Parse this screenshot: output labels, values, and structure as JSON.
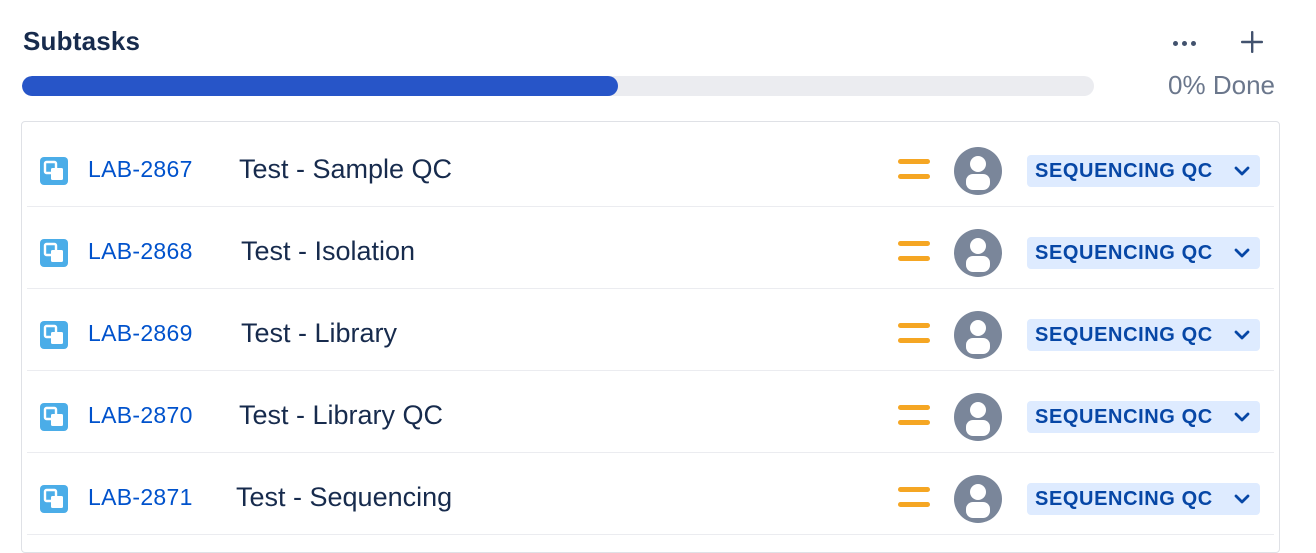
{
  "header": {
    "title": "Subtasks",
    "more_icon": "more-horizontal-icon",
    "add_icon": "plus-icon"
  },
  "progress": {
    "fill_fraction": 0.556,
    "done_text": "0% Done",
    "fill_color": "#2755c8",
    "track_color": "#ebecf0"
  },
  "colors": {
    "key_link": "#0052cc",
    "priority_medium": "#f5a623",
    "status_bg": "#deebff",
    "status_text": "#0747a6",
    "subtask_icon": "#4bade8"
  },
  "subtasks": [
    {
      "key": "LAB-2867",
      "summary": "Test - Sample QC",
      "status": "SEQUENCING QC",
      "priority_icon": "priority-medium-icon",
      "type_icon": "subtask-icon",
      "assignee_icon": "unassigned-avatar-icon"
    },
    {
      "key": "LAB-2868",
      "summary": "Test - Isolation",
      "status": "SEQUENCING QC",
      "priority_icon": "priority-medium-icon",
      "type_icon": "subtask-icon",
      "assignee_icon": "unassigned-avatar-icon"
    },
    {
      "key": "LAB-2869",
      "summary": "Test - Library",
      "status": "SEQUENCING QC",
      "priority_icon": "priority-medium-icon",
      "type_icon": "subtask-icon",
      "assignee_icon": "unassigned-avatar-icon"
    },
    {
      "key": "LAB-2870",
      "summary": "Test - Library QC",
      "status": "SEQUENCING QC",
      "priority_icon": "priority-medium-icon",
      "type_icon": "subtask-icon",
      "assignee_icon": "unassigned-avatar-icon"
    },
    {
      "key": "LAB-2871",
      "summary": "Test - Sequencing",
      "status": "SEQUENCING QC",
      "priority_icon": "priority-medium-icon",
      "type_icon": "subtask-icon",
      "assignee_icon": "unassigned-avatar-icon"
    }
  ]
}
